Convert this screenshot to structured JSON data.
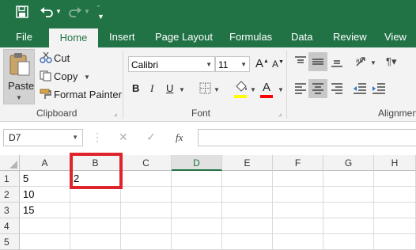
{
  "quick_access": {
    "save_icon": "save-icon",
    "undo_icon": "undo-icon",
    "redo_icon": "redo-icon",
    "customize_icon": "customize-qat-icon"
  },
  "tabs": [
    "File",
    "Home",
    "Insert",
    "Page Layout",
    "Formulas",
    "Data",
    "Review",
    "View"
  ],
  "active_tab": "Home",
  "clipboard": {
    "paste_label": "Paste",
    "cut_label": "Cut",
    "copy_label": "Copy",
    "format_painter_label": "Format Painter",
    "group_label": "Clipboard"
  },
  "font": {
    "font_name": "Calibri",
    "font_size": "11",
    "group_label": "Font",
    "bold": "B",
    "italic": "I",
    "underline": "U",
    "increase_size": "A",
    "decrease_size": "A",
    "font_color_letter": "A",
    "highlight_color": "#ffff00",
    "font_color": "#ff0000"
  },
  "alignment": {
    "group_label": "Alignmen"
  },
  "formula_bar": {
    "name_box": "D7",
    "fx": "fx",
    "formula": ""
  },
  "sheet": {
    "columns": [
      "A",
      "B",
      "C",
      "D",
      "E",
      "F",
      "G",
      "H"
    ],
    "selected_column": "D",
    "rows": [
      "1",
      "2",
      "3",
      "4",
      "5"
    ],
    "cells": {
      "A1": "5",
      "B1": "2",
      "A2": "10",
      "A3": "15"
    },
    "highlight_color": "#e0242c",
    "accent_color": "#217346"
  }
}
